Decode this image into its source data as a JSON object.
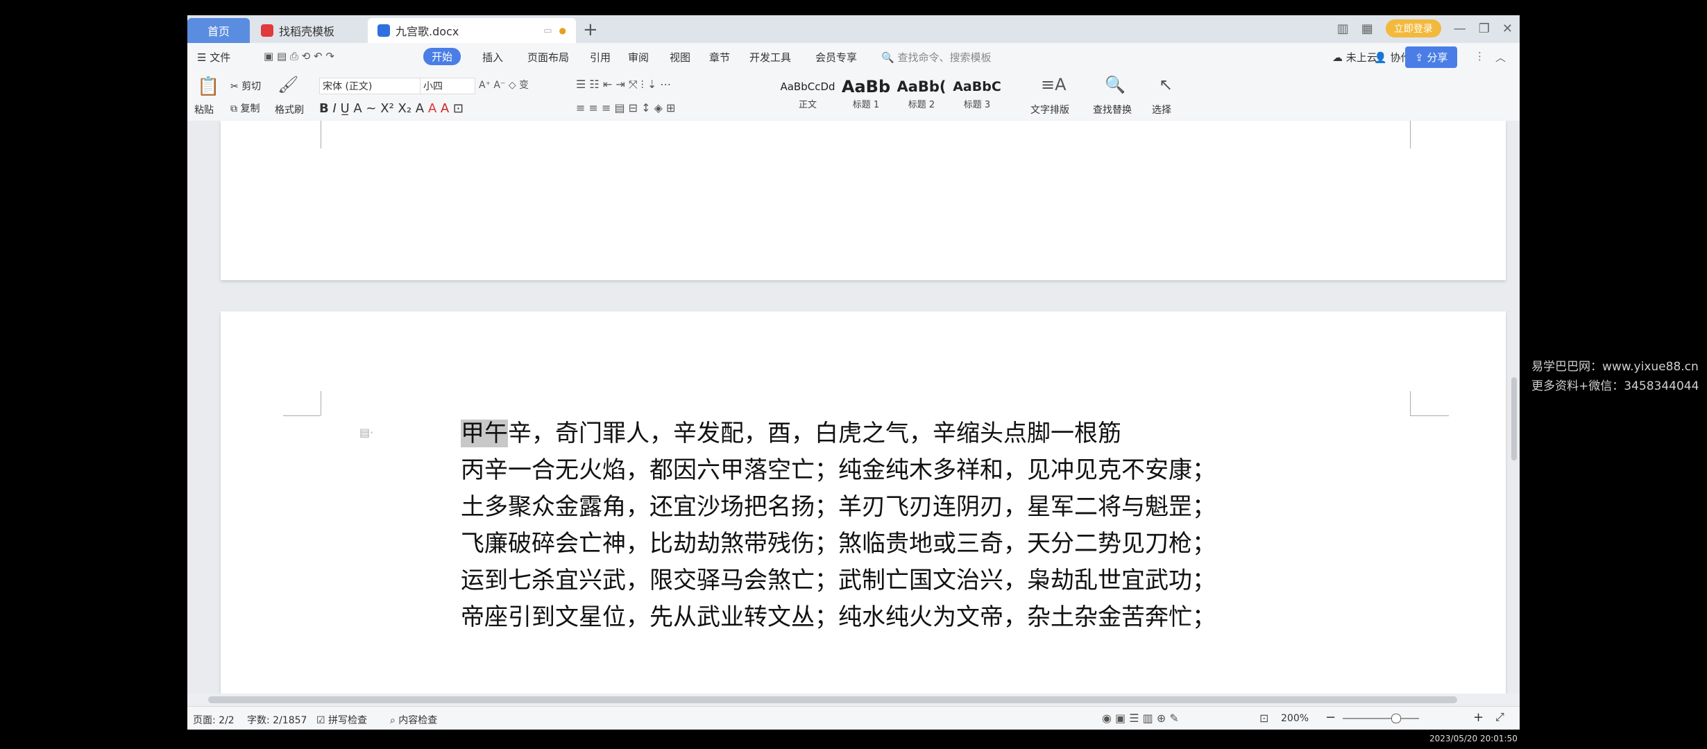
{
  "tabs": {
    "home": "首页",
    "template": "找稻壳模板",
    "document": "九宫歌.docx",
    "login": "立即登录"
  },
  "menubar": {
    "file": "文件",
    "start": "开始",
    "insert": "插入",
    "layout": "页面布局",
    "reference": "引用",
    "review": "审阅",
    "view": "视图",
    "chapter": "章节",
    "devtools": "开发工具",
    "member": "会员专享",
    "search_placeholder": "查找命令、搜索模板",
    "cloud": "未上云",
    "collab": "协作",
    "share": "分享"
  },
  "ribbon": {
    "paste": "粘贴",
    "cut": "剪切",
    "copy": "复制",
    "format_painter": "格式刷",
    "font_name": "宋体 (正文)",
    "font_size": "小四",
    "styles": [
      {
        "preview": "AaBbCcDd",
        "label": "正文"
      },
      {
        "preview": "AaBb",
        "label": "标题 1"
      },
      {
        "preview": "AaBb(",
        "label": "标题 2"
      },
      {
        "preview": "AaBbC",
        "label": "标题 3"
      }
    ],
    "text_layout": "文字排版",
    "find_replace": "查找替换",
    "select": "选择"
  },
  "document": {
    "line1_highlight": "甲午",
    "line1_rest": "辛，奇门罪人，辛发配，酉，白虎之气，辛缩头点脚一根筋",
    "lines": [
      "丙辛一合无火焰，都因六甲落空亡；纯金纯木多祥和，见冲见克不安康；",
      "土多聚众金露角，还宜沙场把名扬；羊刃飞刃连阴刃，星军二将与魁罡；",
      "飞廉破碎会亡神，比劫劫煞带残伤；煞临贵地或三奇，天分二势见刀枪；",
      "运到七杀宜兴武，限交驿马会煞亡；武制亡国文治兴，枭劫乱世宜武功；",
      "帝座引到文星位，先从武业转文丛；纯水纯火为文帝，杂土杂金苦奔忙；"
    ]
  },
  "status": {
    "page": "页面: 2/2",
    "words": "字数: 2/1857",
    "spell": "拼写检查",
    "content": "内容检查",
    "zoom": "200%",
    "zoom_level": 0.7
  },
  "overlay": {
    "watermark1": "易学巴巴网：www.yixue88.cn",
    "watermark2": "更多资料+微信：3458344044",
    "timestamp": "2023/05/20 20:01:50"
  }
}
